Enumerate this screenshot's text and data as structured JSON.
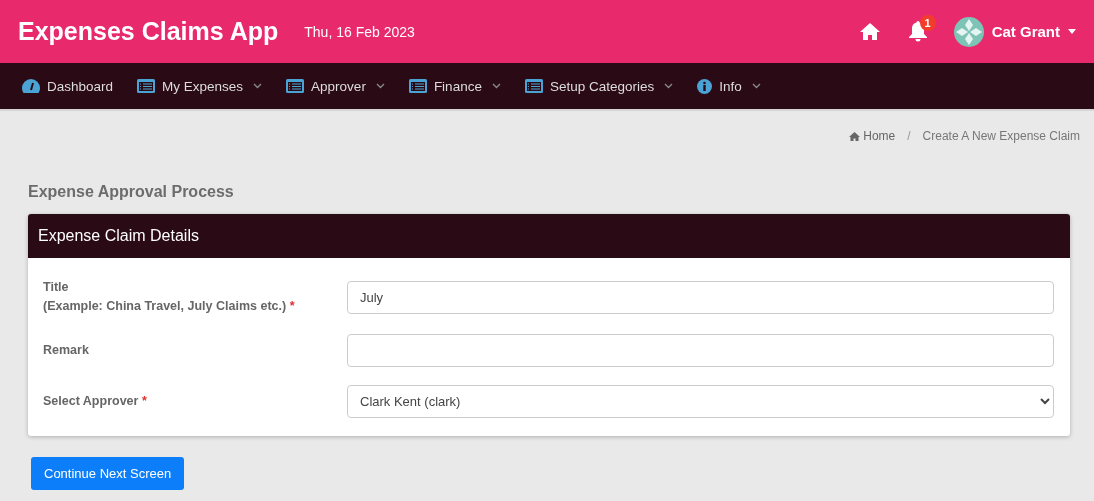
{
  "header": {
    "title": "Expenses Claims App",
    "date": "Thu, 16 Feb 2023",
    "notifications": "1",
    "user": "Cat Grant"
  },
  "nav": [
    {
      "label": "Dashboard",
      "kind": "dashboard",
      "dropdown": false
    },
    {
      "label": "My Expenses",
      "kind": "list",
      "dropdown": true
    },
    {
      "label": "Approver",
      "kind": "list",
      "dropdown": true
    },
    {
      "label": "Finance",
      "kind": "list",
      "dropdown": true
    },
    {
      "label": "Setup Categories",
      "kind": "list",
      "dropdown": true
    },
    {
      "label": "Info",
      "kind": "info",
      "dropdown": true
    }
  ],
  "breadcrumb_separator": "/",
  "breadcrumb": [
    {
      "label": "Home"
    },
    {
      "label": "Create A New Expense Claim"
    }
  ],
  "page_title": "Expense Approval Process",
  "card": {
    "title": "Expense Claim Details",
    "fields": [
      {
        "label": "Title",
        "hint": "(Example: China Travel, July Claims etc.)",
        "required_mark": "*",
        "kind": "text",
        "value": "July"
      },
      {
        "label": "Remark",
        "kind": "text"
      },
      {
        "label": "Select Approver",
        "required_mark": "*",
        "kind": "select",
        "value": "Clark Kent (clark)"
      }
    ]
  },
  "button": "Continue Next Screen"
}
